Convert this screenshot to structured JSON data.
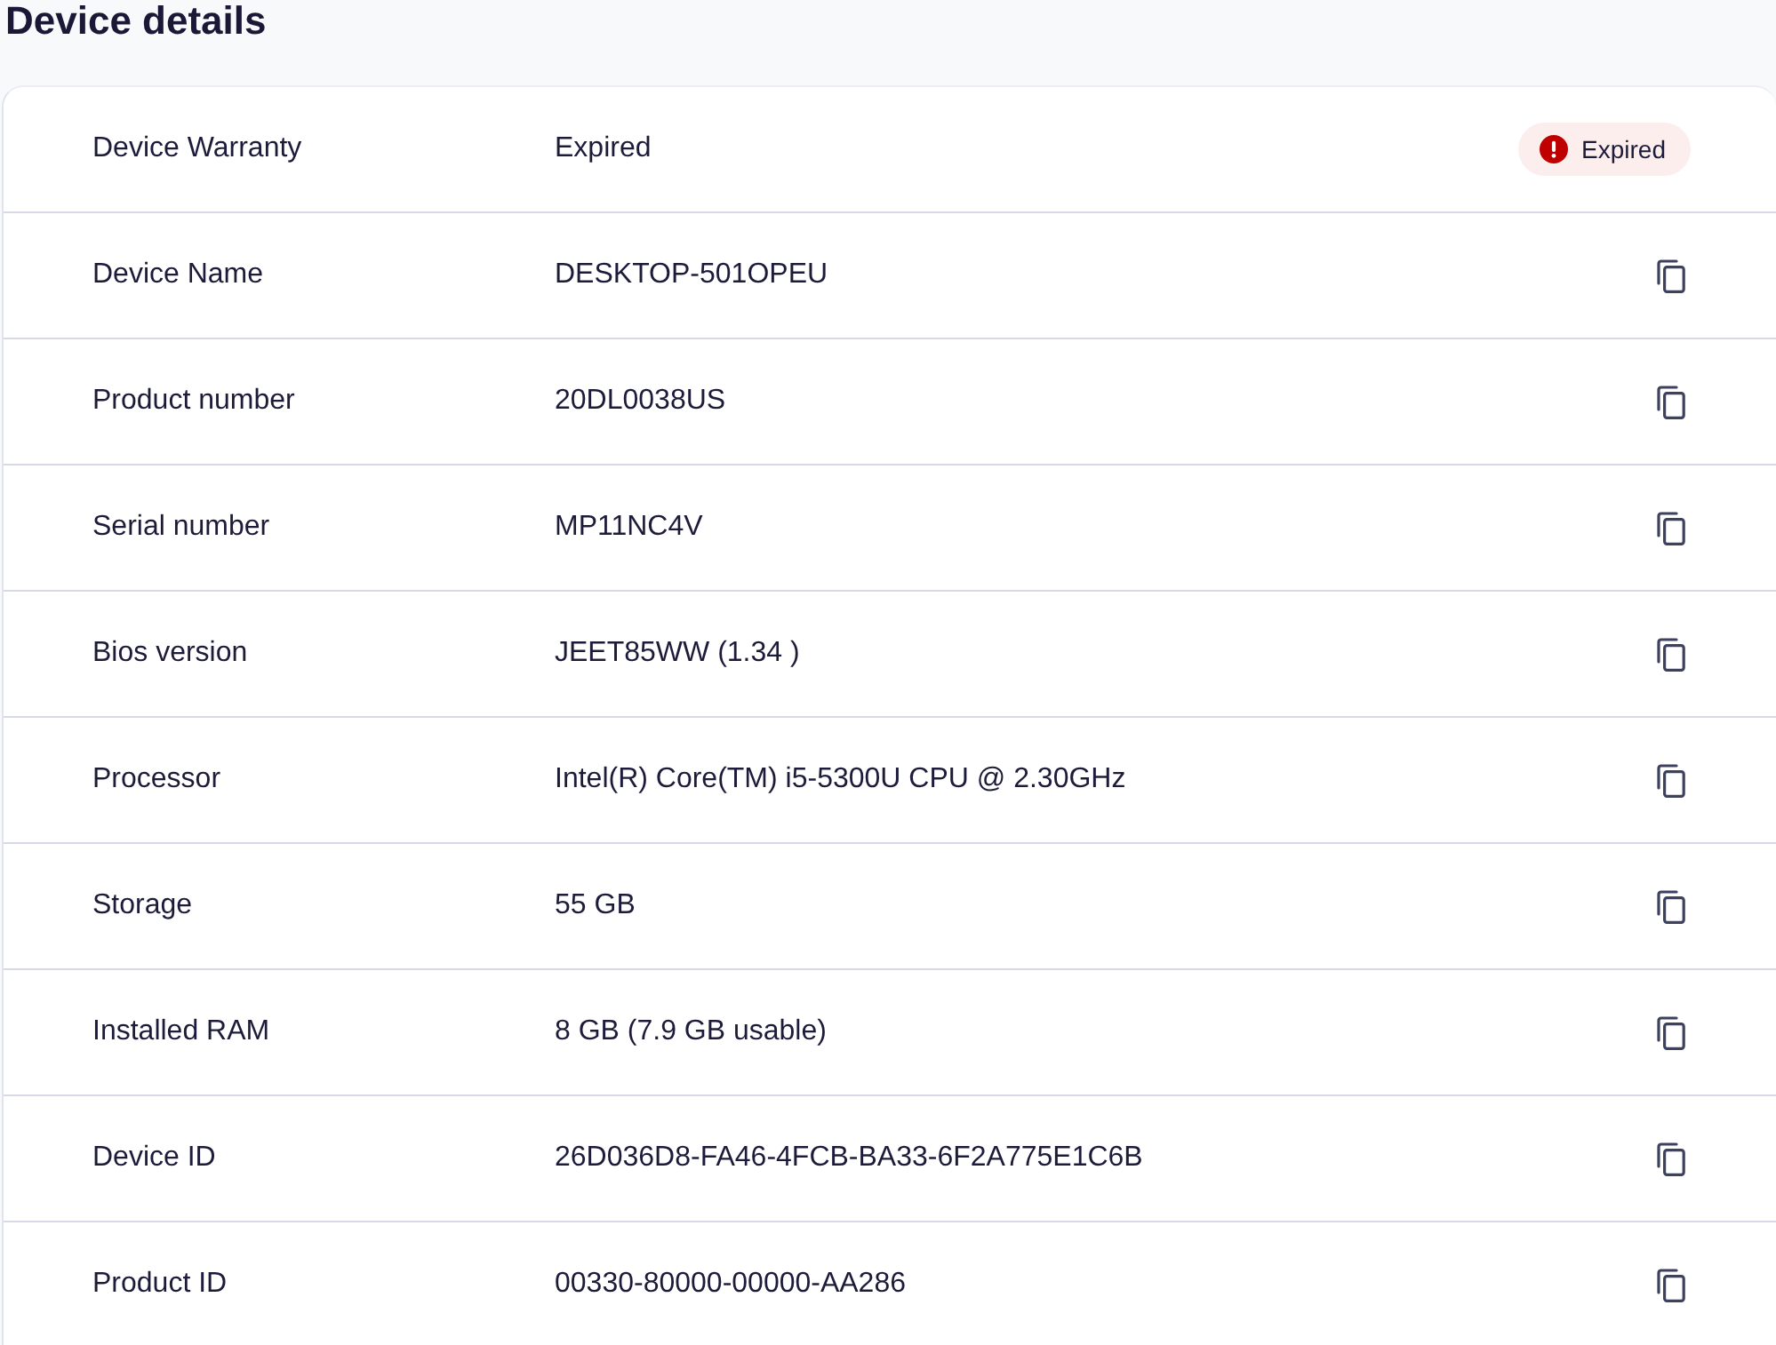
{
  "title": "Device details",
  "rows": [
    {
      "kind": "status",
      "label": "Device Warranty",
      "value": "Expired",
      "badge": "Expired"
    },
    {
      "kind": "copyable",
      "label": "Device Name",
      "value": "DESKTOP-501OPEU"
    },
    {
      "kind": "copyable",
      "label": "Product number",
      "value": "20DL0038US"
    },
    {
      "kind": "copyable",
      "label": "Serial number",
      "value": "MP11NC4V"
    },
    {
      "kind": "copyable",
      "label": "Bios version",
      "value": "JEET85WW (1.34 )"
    },
    {
      "kind": "copyable",
      "label": "Processor",
      "value": "Intel(R) Core(TM) i5-5300U CPU @ 2.30GHz"
    },
    {
      "kind": "copyable",
      "label": "Storage",
      "value": "55 GB"
    },
    {
      "kind": "copyable",
      "label": "Installed RAM",
      "value": "8 GB (7.9 GB usable)"
    },
    {
      "kind": "copyable",
      "label": "Device ID",
      "value": "26D036D8-FA46-4FCB-BA33-6F2A775E1C6B"
    },
    {
      "kind": "copyable",
      "label": "Product ID",
      "value": "00330-80000-00000-AA286"
    }
  ]
}
